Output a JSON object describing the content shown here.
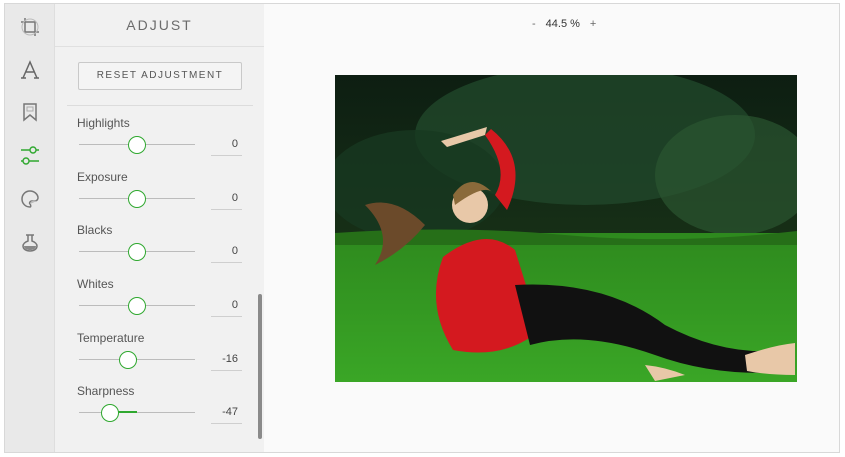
{
  "panel": {
    "title": "ADJUST",
    "reset_label": "RESET ADJUSTMENT"
  },
  "sidebar_icons": [
    "crop-icon",
    "text-icon",
    "bookmark-icon",
    "adjust-sliders-icon",
    "palette-icon",
    "flask-icon"
  ],
  "active_icon": "adjust-sliders-icon",
  "sliders": [
    {
      "label": "Highlights",
      "value": "0",
      "position": 0.5
    },
    {
      "label": "Exposure",
      "value": "0",
      "position": 0.5
    },
    {
      "label": "Blacks",
      "value": "0",
      "position": 0.5
    },
    {
      "label": "Whites",
      "value": "0",
      "position": 0.5
    },
    {
      "label": "Temperature",
      "value": "-16",
      "position": 0.42
    },
    {
      "label": "Sharpness",
      "value": "-47",
      "position": 0.265
    }
  ],
  "zoom": {
    "minus": "-",
    "level": "44.5 %",
    "plus": "+"
  },
  "colors": {
    "accent": "#2fa82f",
    "panel_bg": "#f1f1f1",
    "iconbar_bg": "#e9e9e9"
  }
}
